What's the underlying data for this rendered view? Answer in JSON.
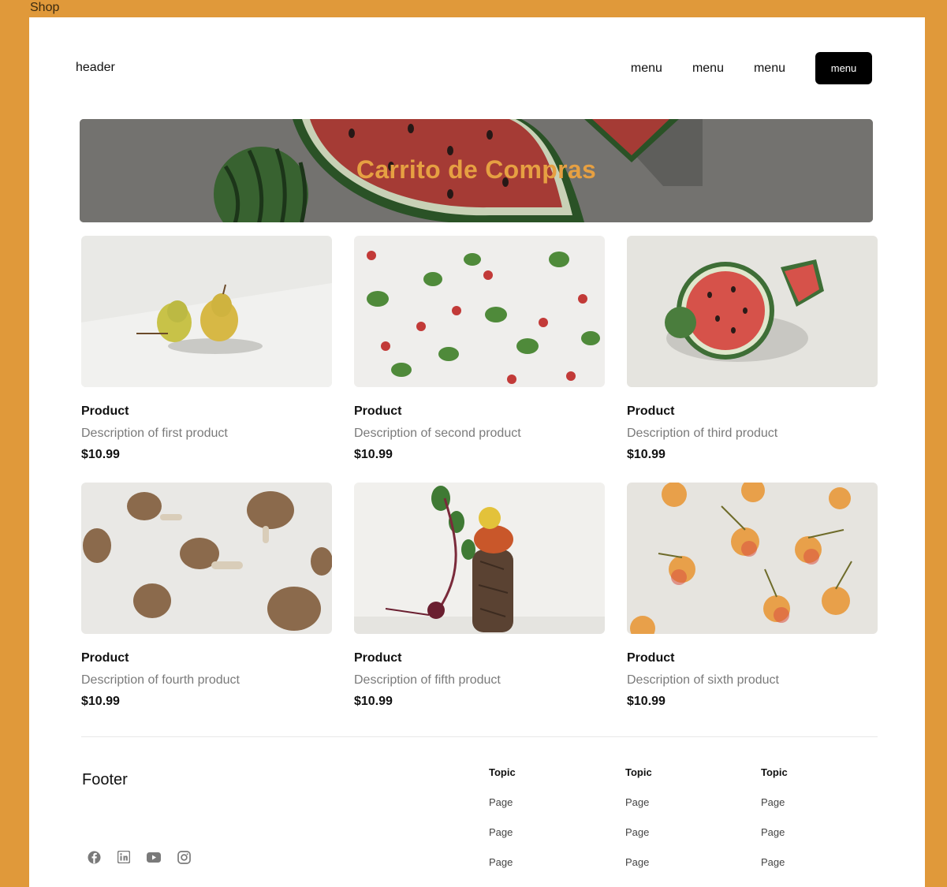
{
  "frame": {
    "label": "Shop"
  },
  "header": {
    "logo": "header",
    "nav": [
      "menu",
      "menu",
      "menu"
    ],
    "cta": "menu"
  },
  "hero": {
    "title": "Carrito de Compras",
    "title_color": "#e6a042"
  },
  "products": [
    {
      "name": "Product",
      "description": "Description of first product",
      "price": "$10.99",
      "image": "pears"
    },
    {
      "name": "Product",
      "description": "Description of second product",
      "price": "$10.99",
      "image": "radishes"
    },
    {
      "name": "Product",
      "description": "Description of third product",
      "price": "$10.99",
      "image": "watermelon"
    },
    {
      "name": "Product",
      "description": "Description of fourth product",
      "price": "$10.99",
      "image": "mushrooms"
    },
    {
      "name": "Product",
      "description": "Description of fifth product",
      "price": "$10.99",
      "image": "beet-pumpkin-bread"
    },
    {
      "name": "Product",
      "description": "Description of sixth product",
      "price": "$10.99",
      "image": "cherries"
    }
  ],
  "footer": {
    "brand": "Footer",
    "social": [
      "facebook-icon",
      "linkedin-icon",
      "youtube-icon",
      "instagram-icon"
    ],
    "columns": [
      {
        "topic": "Topic",
        "pages": [
          "Page",
          "Page",
          "Page"
        ]
      },
      {
        "topic": "Topic",
        "pages": [
          "Page",
          "Page",
          "Page"
        ]
      },
      {
        "topic": "Topic",
        "pages": [
          "Page",
          "Page",
          "Page"
        ]
      }
    ]
  },
  "colors": {
    "frame": "#e0993a",
    "accent": "#e6a042",
    "cta": "#000000"
  }
}
